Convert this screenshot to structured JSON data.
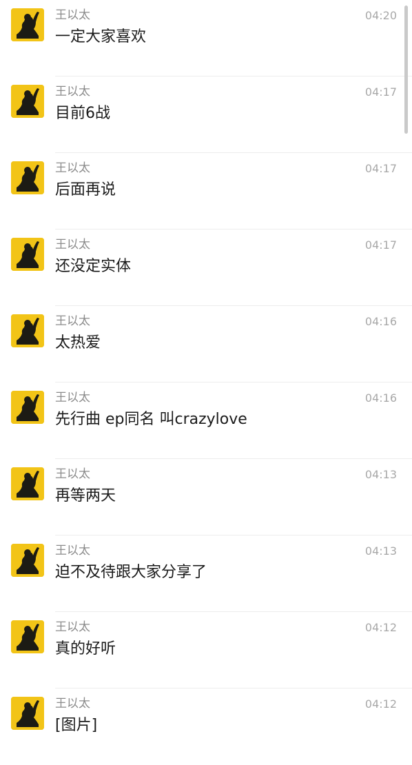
{
  "chat": {
    "messages": [
      {
        "sender": "王以太",
        "time": "04:20",
        "text": "一定大家喜欢"
      },
      {
        "sender": "王以太",
        "time": "04:17",
        "text": "目前6战"
      },
      {
        "sender": "王以太",
        "time": "04:17",
        "text": "后面再说"
      },
      {
        "sender": "王以太",
        "time": "04:17",
        "text": "还没定实体"
      },
      {
        "sender": "王以太",
        "time": "04:16",
        "text": "太热爱"
      },
      {
        "sender": "王以太",
        "time": "04:16",
        "text": "先行曲 ep同名 叫crazylove"
      },
      {
        "sender": "王以太",
        "time": "04:13",
        "text": "再等两天"
      },
      {
        "sender": "王以太",
        "time": "04:13",
        "text": "迫不及待跟大家分享了"
      },
      {
        "sender": "王以太",
        "time": "04:12",
        "text": "真的好听"
      },
      {
        "sender": "王以太",
        "time": "04:12",
        "text": "[图片]"
      }
    ]
  },
  "colors": {
    "avatar_bg": "#f2c417",
    "avatar_figure": "#1c1b14"
  },
  "icons": {
    "avatar": "person-raising-arm-silhouette-icon"
  }
}
